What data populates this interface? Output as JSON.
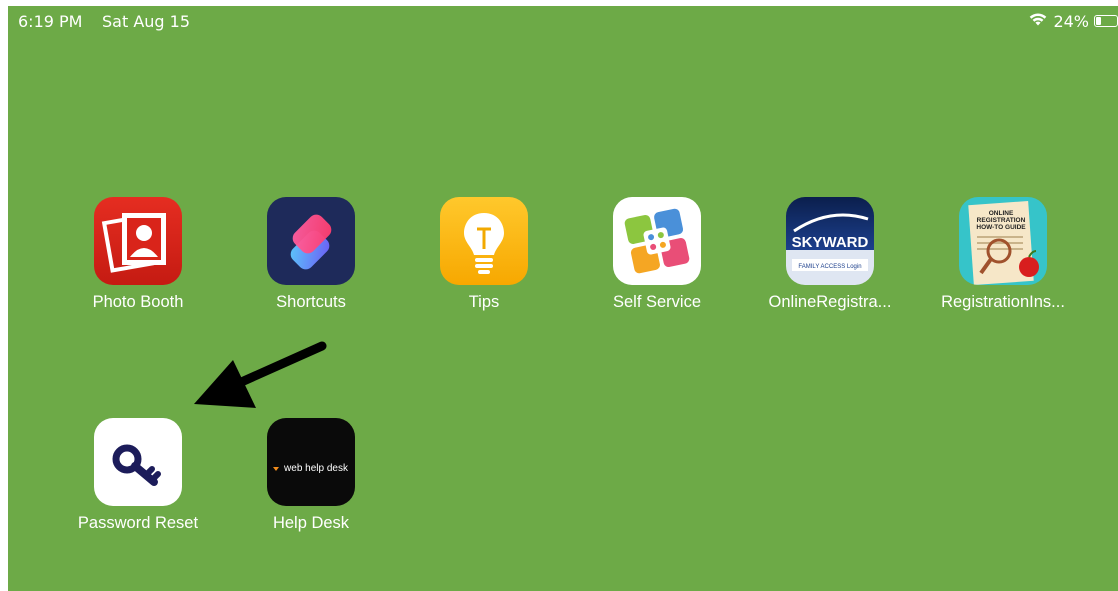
{
  "status_bar": {
    "time": "6:19 PM",
    "date": "Sat Aug 15",
    "battery_percent": "24%",
    "battery_level": 0.24,
    "wifi_icon": "wifi-icon"
  },
  "apps": [
    {
      "label": "Photo Booth",
      "icon": "photo-booth-icon"
    },
    {
      "label": "Shortcuts",
      "icon": "shortcuts-icon"
    },
    {
      "label": "Tips",
      "icon": "tips-lightbulb-icon"
    },
    {
      "label": "Self Service",
      "icon": "self-service-icon"
    },
    {
      "label": "OnlineRegistra...",
      "icon": "skyward-icon",
      "icon_text": "SKYWARD",
      "icon_subtext": "FAMILY ACCESS Login"
    },
    {
      "label": "RegistrationIns...",
      "icon": "registration-guide-icon",
      "icon_text": "ONLINE REGISTRATION HOW-TO GUIDE"
    },
    {
      "label": "Password Reset",
      "icon": "key-icon"
    },
    {
      "label": "Help Desk",
      "icon": "web-help-desk-icon",
      "icon_text": "web help desk"
    }
  ],
  "annotation": {
    "icon": "arrow-pointer-icon"
  },
  "colors": {
    "wallpaper": "#6daa47"
  }
}
